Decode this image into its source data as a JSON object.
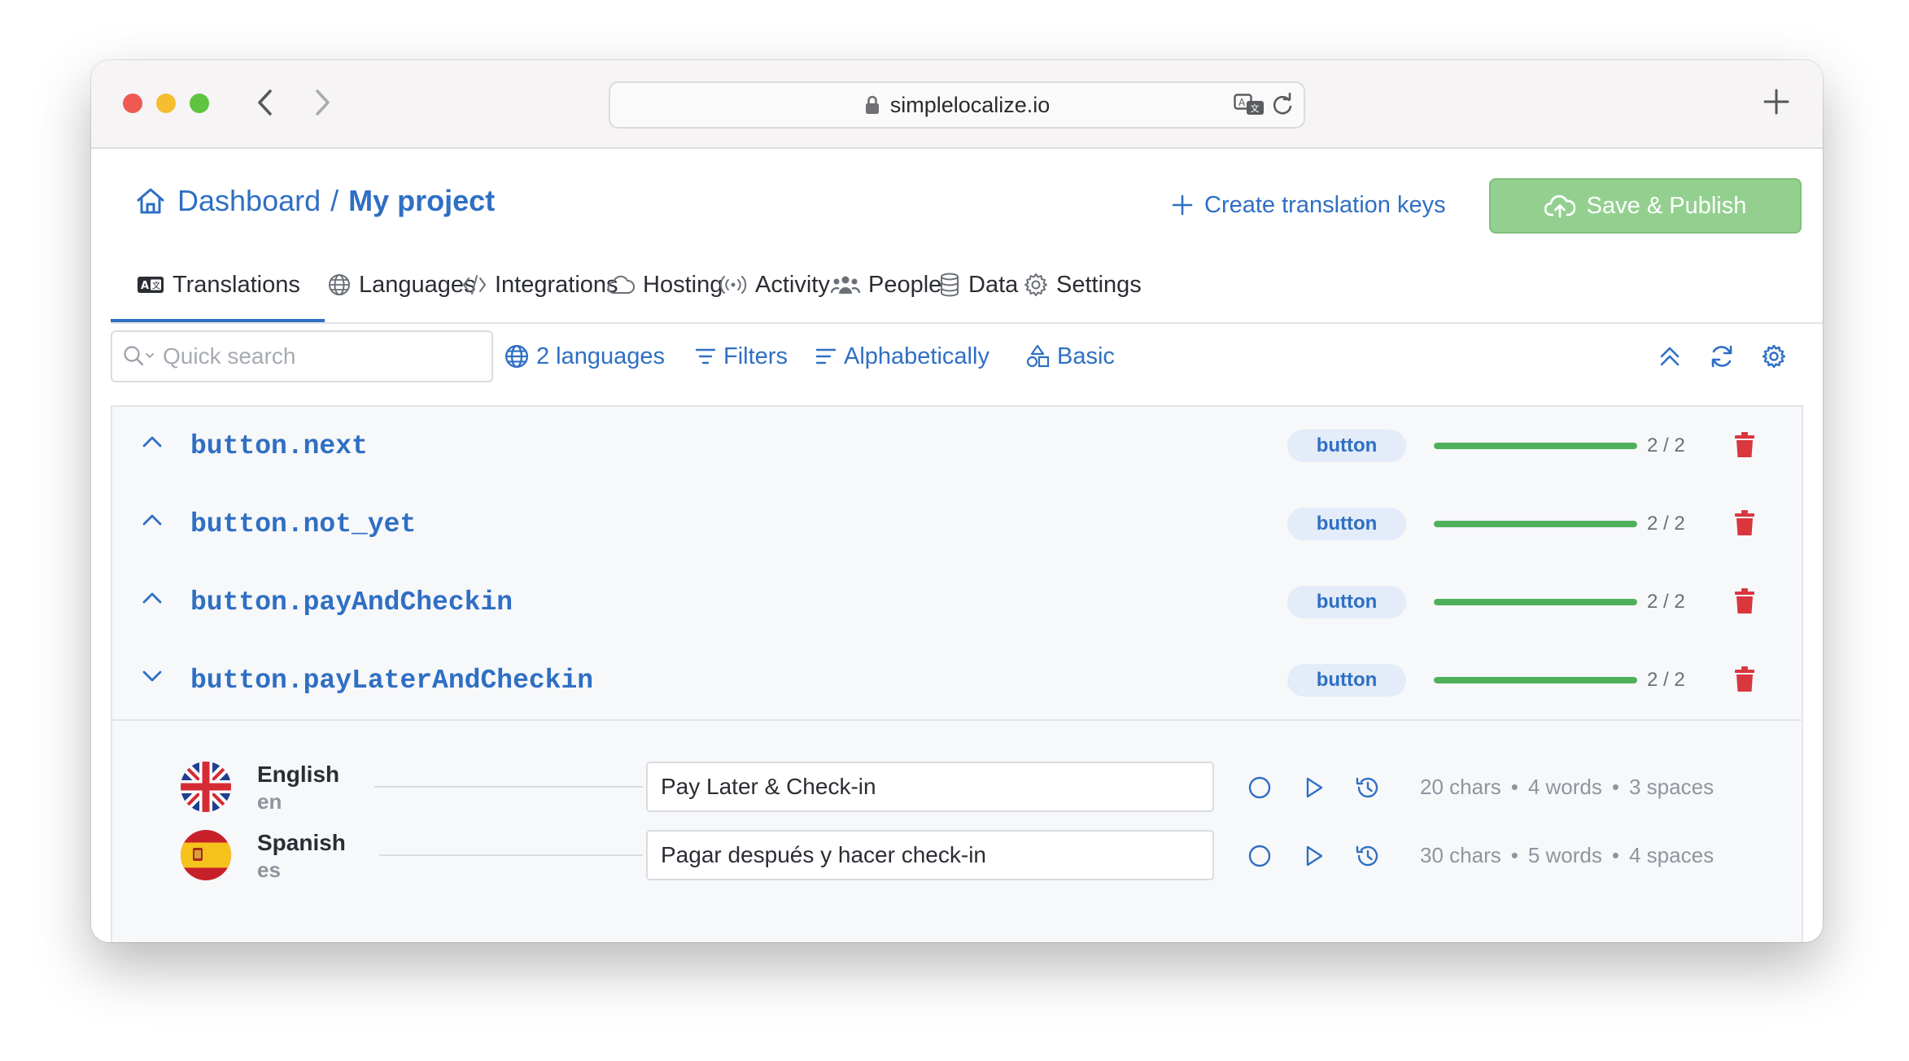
{
  "browser": {
    "url": "simplelocalize.io"
  },
  "header": {
    "breadcrumb_root": "Dashboard",
    "breadcrumb_separator": "/",
    "breadcrumb_current": "My project",
    "create_keys_label": "Create translation keys",
    "save_publish_label": "Save & Publish"
  },
  "tabs": [
    {
      "label": "Translations",
      "icon": "translate-badge-icon",
      "active": true
    },
    {
      "label": "Languages",
      "icon": "globe-icon"
    },
    {
      "label": "Integrations",
      "icon": "code-icon"
    },
    {
      "label": "Hosting",
      "icon": "cloud-icon"
    },
    {
      "label": "Activity",
      "icon": "broadcast-icon"
    },
    {
      "label": "People",
      "icon": "people-icon"
    },
    {
      "label": "Data",
      "icon": "database-icon"
    },
    {
      "label": "Settings",
      "icon": "gear-icon"
    }
  ],
  "toolbar": {
    "search_placeholder": "Quick search",
    "languages_label": "2 languages",
    "filters_label": "Filters",
    "sort_label": "Alphabetically",
    "view_label": "Basic"
  },
  "keys": [
    {
      "key": "button.next",
      "tag": "button",
      "progress": "2 / 2",
      "fraction": 1.0,
      "expanded": false
    },
    {
      "key": "button.not_yet",
      "tag": "button",
      "progress": "2 / 2",
      "fraction": 1.0,
      "expanded": false
    },
    {
      "key": "button.payAndCheckin",
      "tag": "button",
      "progress": "2 / 2",
      "fraction": 1.0,
      "expanded": false
    },
    {
      "key": "button.payLaterAndCheckin",
      "tag": "button",
      "progress": "2 / 2",
      "fraction": 1.0,
      "expanded": true
    }
  ],
  "translations": [
    {
      "language": "English",
      "code": "en",
      "flag": "uk-flag-icon",
      "value": "Pay Later & Check-in",
      "chars": "20 chars",
      "words": "4 words",
      "spaces": "3 spaces"
    },
    {
      "language": "Spanish",
      "code": "es",
      "flag": "spain-flag-icon",
      "value": "Pagar después y hacer check-in",
      "chars": "30 chars",
      "words": "5 words",
      "spaces": "4 spaces"
    }
  ],
  "colors": {
    "accent": "#2f6fc4",
    "success": "#4fb05c",
    "danger": "#d9363e",
    "save_button": "#93d08f"
  }
}
